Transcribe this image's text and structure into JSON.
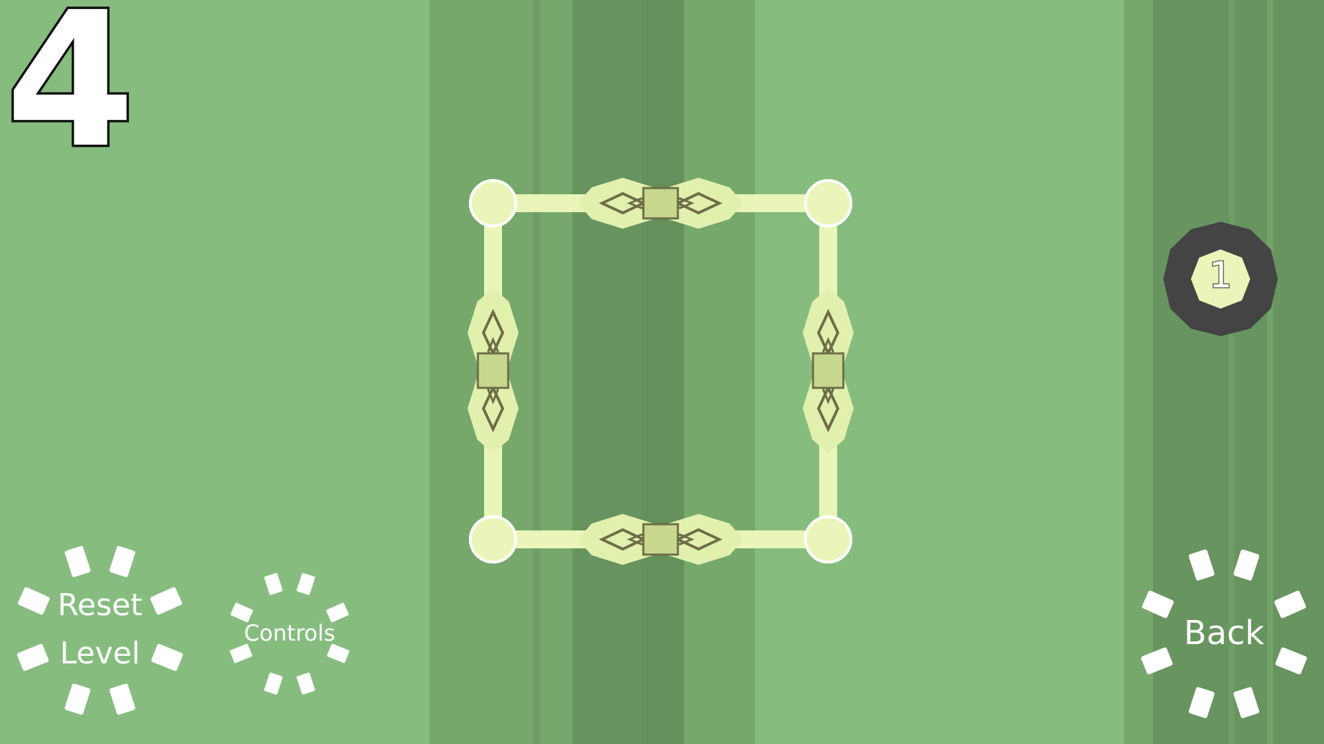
{
  "level": {
    "number": "4"
  },
  "buttons": {
    "reset_line1": "Reset",
    "reset_line2": "Level",
    "controls": "Controls",
    "back": "Back"
  },
  "counter": {
    "value": "1"
  },
  "colors": {
    "background": "#86bd7f",
    "band_mid": "#76a86c",
    "band_dark": "#67945f",
    "puzzle_fill": "#eaf5b9",
    "puzzle_outline": "#6d6d47",
    "counter_ring": "#444444",
    "button_white": "#ffffff"
  },
  "icons": {
    "corner_node": "circle-node-icon",
    "connector": "diamond-connector-icon",
    "counter_badge": "octagon-badge-icon",
    "burst": "burst-ring-icon"
  }
}
